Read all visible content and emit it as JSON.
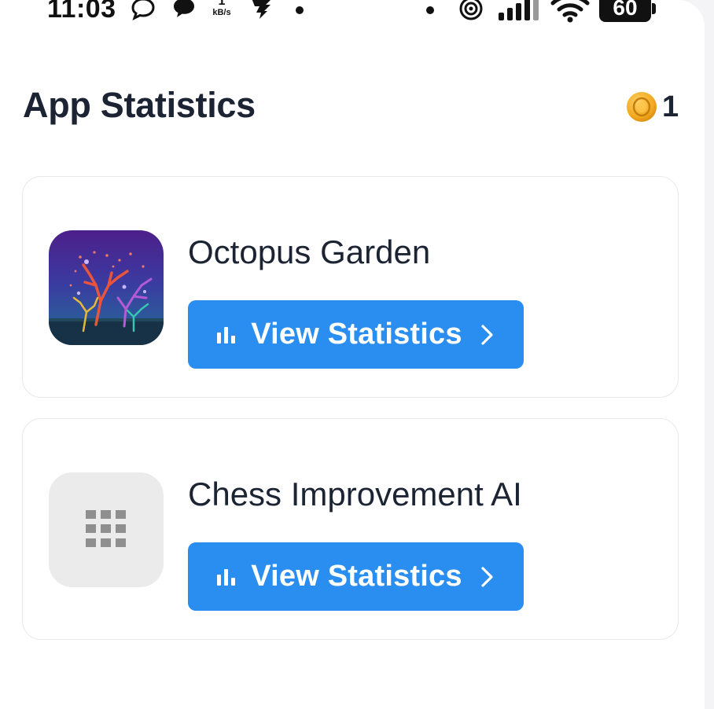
{
  "status_bar": {
    "time": "11:03",
    "net_speed_value": "1",
    "net_speed_unit": "kB/s",
    "battery": "60"
  },
  "header": {
    "title": "App Statistics",
    "coin_count": "1"
  },
  "apps": [
    {
      "name": "Octopus Garden",
      "icon": "octopus-garden-app-icon",
      "button_label": "View Statistics",
      "button_icon": "bar-chart-icon"
    },
    {
      "name": "Chess Improvement AI",
      "icon": "grid-placeholder-icon",
      "button_label": "View Statistics",
      "button_icon": "bar-chart-icon"
    }
  ],
  "colors": {
    "accent": "#2a8df0",
    "text": "#1c2434",
    "coin": "#f2b02a"
  }
}
